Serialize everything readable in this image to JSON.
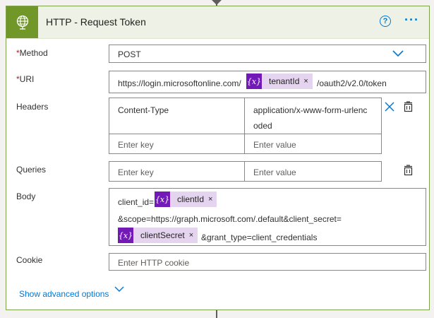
{
  "header": {
    "title": "HTTP - Request Token",
    "help_symbol": "?",
    "more_symbol": "···"
  },
  "method": {
    "label": "Method",
    "value": "POST"
  },
  "uri": {
    "label": "URI",
    "prefix": "https://login.microsoftonline.com/",
    "token": "tenantId",
    "suffix": "/oauth2/v2.0/token"
  },
  "headers": {
    "label": "Headers",
    "rows": [
      {
        "key": "Content-Type",
        "value_line1": "application/x-www-form-urlenc",
        "value_line2": "oded"
      }
    ],
    "key_placeholder": "Enter key",
    "value_placeholder": "Enter value"
  },
  "queries": {
    "label": "Queries",
    "key_placeholder": "Enter key",
    "value_placeholder": "Enter value"
  },
  "body": {
    "label": "Body",
    "part1": "client_id=",
    "token1": "clientId",
    "part2": "&scope=https://graph.microsoft.com/.default&client_secret=",
    "token2": "clientSecret",
    "part3": "&grant_type=client_credentials"
  },
  "cookie": {
    "label": "Cookie",
    "placeholder": "Enter HTTP cookie"
  },
  "advanced_options": "Show advanced options",
  "required_marker": "*",
  "token_icon_text": "{x}",
  "token_remove": "×",
  "colors": {
    "header_icon_bg": "#709727",
    "token_bg": "#e5d4ef",
    "token_icon_bg": "#7219b8",
    "link": "#0078d4"
  }
}
